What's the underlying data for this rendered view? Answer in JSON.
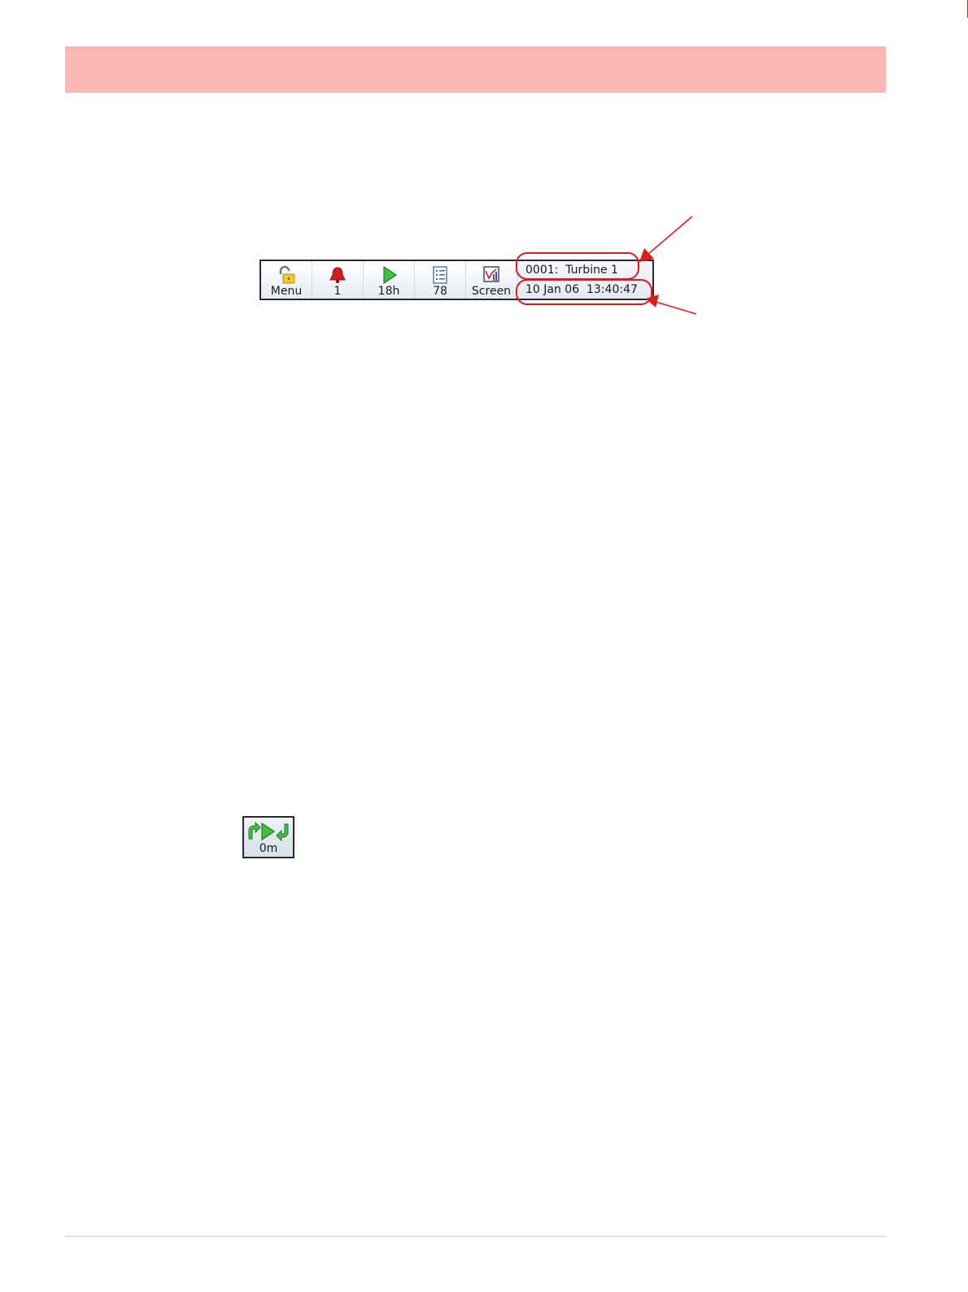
{
  "status_bar": {
    "buttons": [
      {
        "icon": "padlock-icon",
        "label": "Menu"
      },
      {
        "icon": "alarm-bell-icon",
        "label": "1"
      },
      {
        "icon": "play-icon",
        "label": "18h"
      },
      {
        "icon": "message-list-icon",
        "label": "78"
      },
      {
        "icon": "screen-chart-icon",
        "label": "Screen"
      }
    ],
    "recorder_name": "0001:  Turbine 1",
    "date_time": "10 Jan 06  13:40:47"
  },
  "replay_button": {
    "icon": "replay-arrows-play-icon",
    "label": "0m"
  },
  "colors": {
    "header_band": "#fbb6b6",
    "annotation_red": "#e01a1a"
  }
}
